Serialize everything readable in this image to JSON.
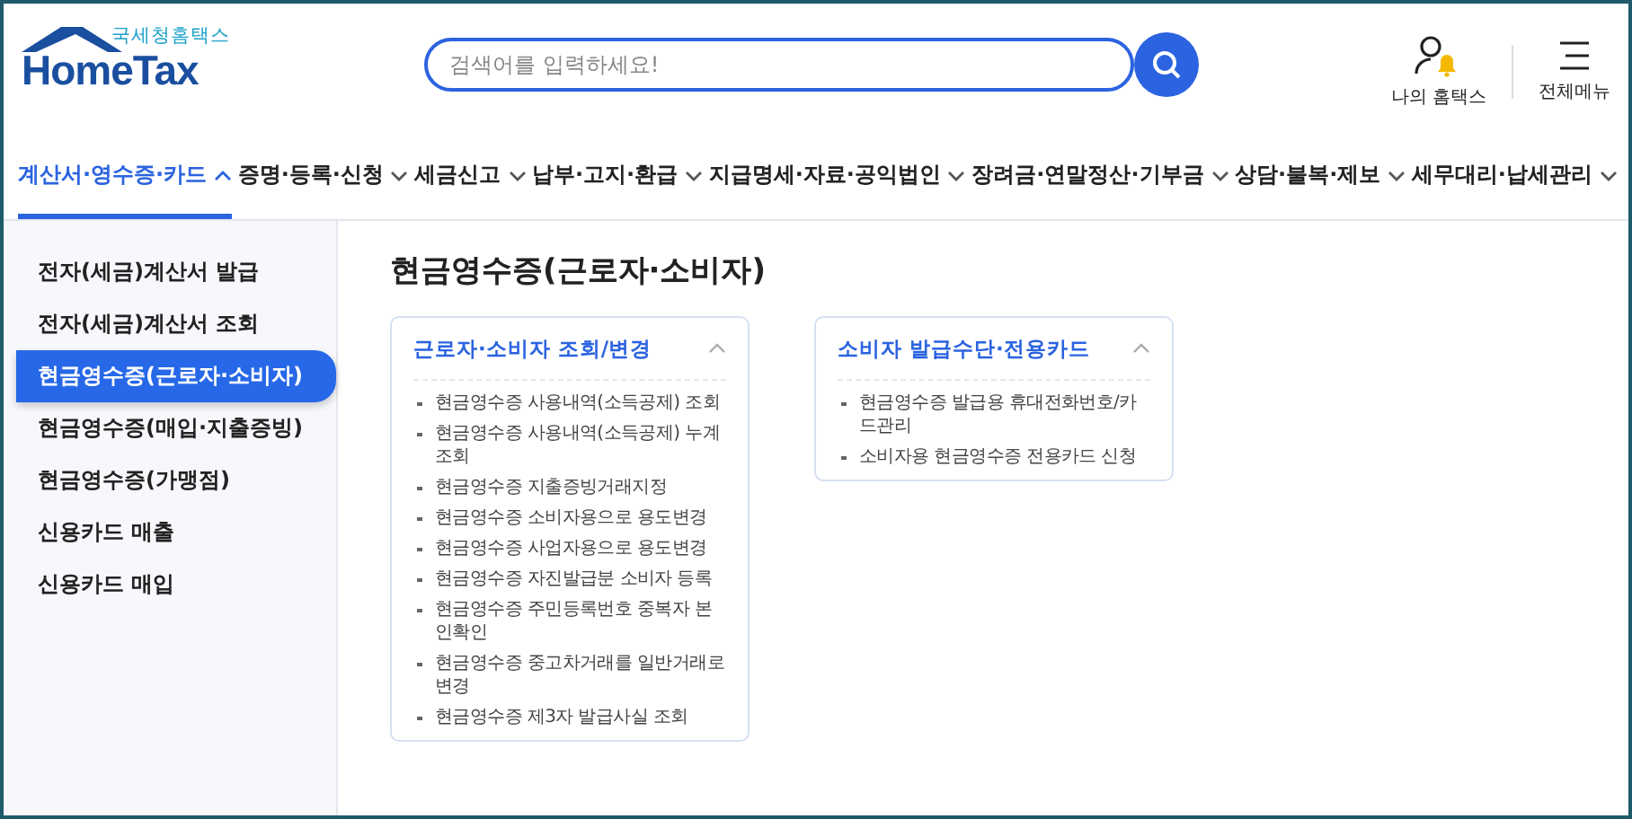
{
  "logo": {
    "subtitle": "국세청홈택스",
    "name": "HomeTax"
  },
  "search": {
    "placeholder": "검색어를 입력하세요!"
  },
  "header_links": [
    {
      "kind": "account",
      "label": "나의 홈택스"
    },
    {
      "kind": "menu",
      "label": "전체메뉴"
    }
  ],
  "nav": [
    {
      "label": "계산서·영수증·카드",
      "selected": true
    },
    {
      "label": "증명·등록·신청",
      "selected": false
    },
    {
      "label": "세금신고",
      "selected": false
    },
    {
      "label": "납부·고지·환급",
      "selected": false
    },
    {
      "label": "지급명세·자료·공익법인",
      "selected": false
    },
    {
      "label": "장려금·연말정산·기부금",
      "selected": false
    },
    {
      "label": "상담·불복·제보",
      "selected": false
    },
    {
      "label": "세무대리·납세관리",
      "selected": false
    }
  ],
  "sidebar": {
    "items": [
      {
        "label": "전자(세금)계산서 발급",
        "selected": false
      },
      {
        "label": "전자(세금)계산서 조회",
        "selected": false
      },
      {
        "label": "현금영수증(근로자·소비자)",
        "selected": true
      },
      {
        "label": "현금영수증(매입·지출증빙)",
        "selected": false
      },
      {
        "label": "현금영수증(가맹점)",
        "selected": false
      },
      {
        "label": "신용카드 매출",
        "selected": false
      },
      {
        "label": "신용카드 매입",
        "selected": false
      }
    ]
  },
  "page_title": "현금영수증(근로자·소비자)",
  "cards": [
    {
      "title": "근로자·소비자 조회/변경",
      "expanded": true,
      "items": [
        "현금영수증 사용내역(소득공제) 조회",
        "현금영수증 사용내역(소득공제) 누계조회",
        "현금영수증 지출증빙거래지정",
        "현금영수증 소비자용으로 용도변경",
        "현금영수증 사업자용으로 용도변경",
        "현금영수증 자진발급분 소비자 등록",
        "현금영수증 주민등록번호 중복자 본인확인",
        "현금영수증 중고차거래를 일반거래로 변경",
        "현금영수증 제3자 발급사실 조회"
      ]
    },
    {
      "title": "소비자 발급수단·전용카드",
      "expanded": true,
      "items": [
        "현금영수증 발급용 휴대전화번호/카드관리",
        "소비자용 현금영수증 전용카드 신청"
      ]
    }
  ]
}
